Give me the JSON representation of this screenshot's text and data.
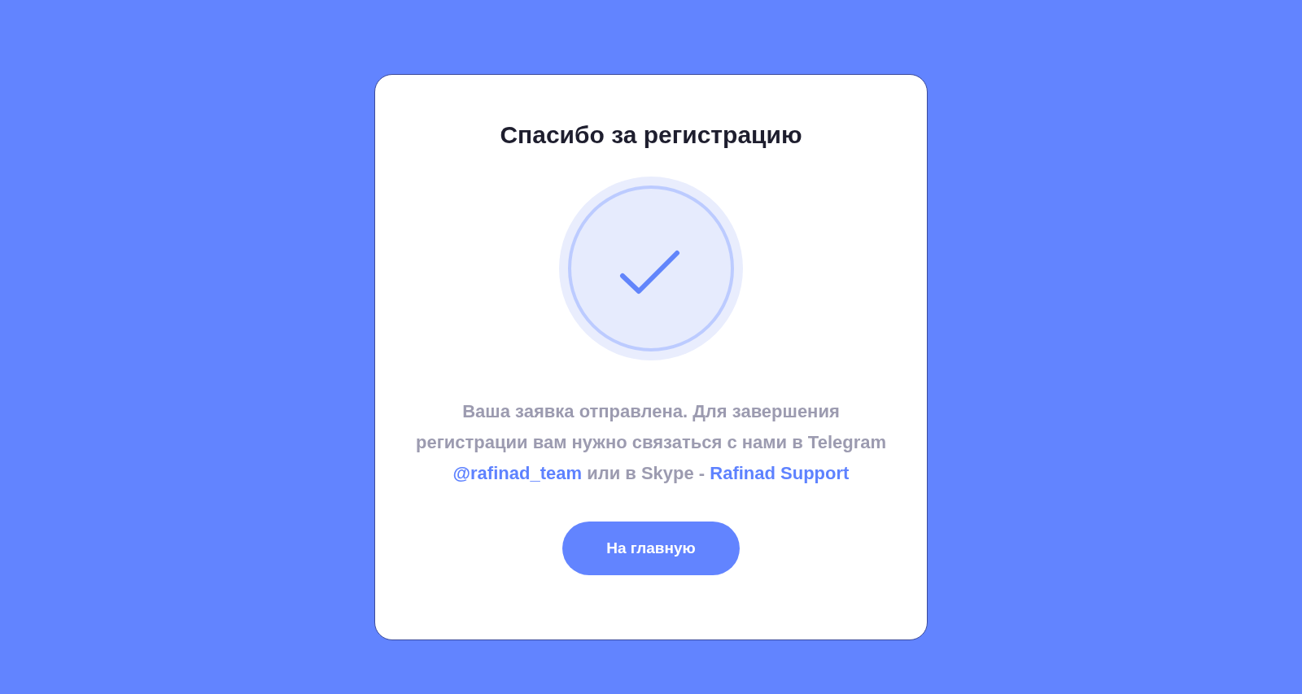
{
  "title": "Спасибо за регистрацию",
  "message": [
    {
      "kind": "text",
      "text": "Ваша заявка отправлена. Для завершения регистрации вам нужно связаться с нами в Telegram "
    },
    {
      "kind": "link",
      "text": "@rafinad_team"
    },
    {
      "kind": "text",
      "text": " или в Skype - "
    },
    {
      "kind": "link",
      "text": "Rafinad Support"
    }
  ],
  "button": "На главную"
}
